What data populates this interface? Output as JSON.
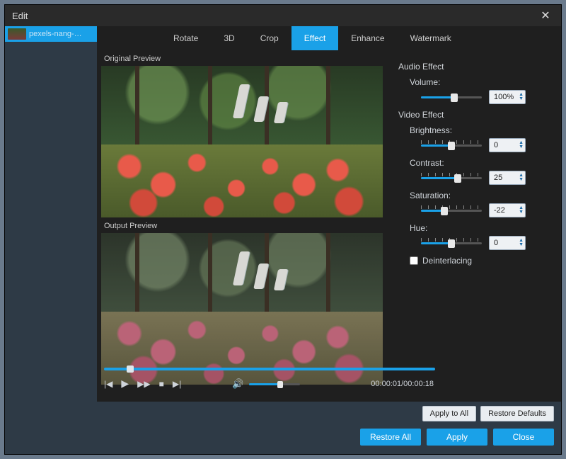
{
  "window": {
    "title": "Edit"
  },
  "sidebar": {
    "file": "pexels-nang-…"
  },
  "tabs": [
    "Rotate",
    "3D",
    "Crop",
    "Effect",
    "Enhance",
    "Watermark"
  ],
  "activeTab": "Effect",
  "preview": {
    "original_label": "Original Preview",
    "output_label": "Output Preview"
  },
  "audio": {
    "section": "Audio Effect",
    "volume_label": "Volume:",
    "volume_value": "100%",
    "volume_pct": 55
  },
  "video": {
    "section": "Video Effect",
    "brightness_label": "Brightness:",
    "brightness_value": "0",
    "brightness_pct": 50,
    "contrast_label": "Contrast:",
    "contrast_value": "25",
    "contrast_pct": 60,
    "saturation_label": "Saturation:",
    "saturation_value": "-22",
    "saturation_pct": 38,
    "hue_label": "Hue:",
    "hue_value": "0",
    "hue_pct": 50,
    "deinterlace_label": "Deinterlacing",
    "deinterlace_checked": false
  },
  "playback": {
    "position_pct": 5,
    "time": "00:00:01/00:00:18",
    "volume_pct": 60
  },
  "buttons": {
    "apply_all": "Apply to All",
    "restore_defaults": "Restore Defaults",
    "restore_all": "Restore All",
    "apply": "Apply",
    "close": "Close"
  }
}
